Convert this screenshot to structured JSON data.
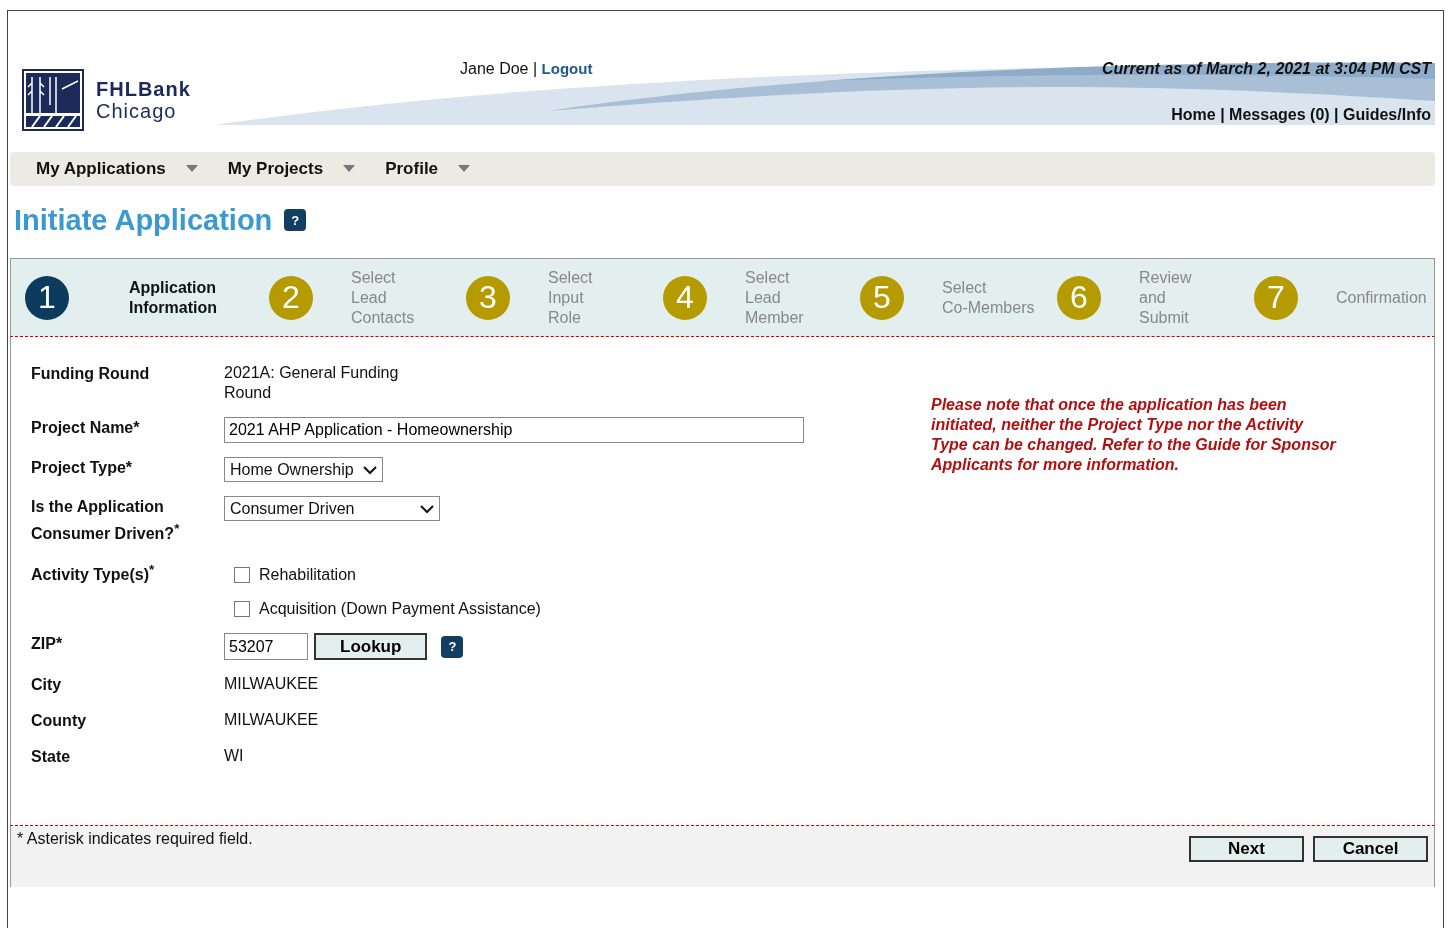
{
  "header": {
    "logo": {
      "line1": "FHLBank",
      "line2": "Chicago"
    },
    "user": "Jane Doe",
    "logout": "Logout",
    "timestamp": "Current as of March 2, 2021 at 3:04 PM CST",
    "links": [
      "Home",
      "Messages (0)",
      "Guides/Info"
    ],
    "separators": [
      "|",
      "|",
      "|"
    ]
  },
  "nav": [
    "My Applications",
    "My Projects",
    "Profile"
  ],
  "title": "Initiate Application",
  "help": "?",
  "steps": [
    {
      "number": "1",
      "lines": [
        "Application",
        "Information"
      ],
      "selected": true
    },
    {
      "number": "2",
      "lines": [
        "Select",
        "Lead",
        "Contacts"
      ],
      "selected": false
    },
    {
      "number": "3",
      "lines": [
        "Select",
        "Input",
        "Role"
      ],
      "selected": false
    },
    {
      "number": "4",
      "lines": [
        "Select",
        "Lead",
        "Member"
      ],
      "selected": false
    },
    {
      "number": "5",
      "lines": [
        "Select",
        "Co-Members"
      ],
      "selected": false
    },
    {
      "number": "6",
      "lines": [
        "Review",
        "and",
        "Submit"
      ],
      "selected": false
    },
    {
      "number": "7",
      "lines": [
        "Confirmation"
      ],
      "selected": false
    }
  ],
  "form": [
    {
      "kind": "text",
      "label": "Funding Round",
      "value": "2021A: General Funding Round"
    },
    {
      "kind": "input",
      "label": "Project Name*",
      "value": "2021 AHP Application - Homeownership"
    },
    {
      "kind": "select",
      "label": "Project Type*",
      "value": "Home Ownership"
    },
    {
      "kind": "select",
      "label": "Is the Application Consumer Driven?$^{*}$",
      "value": "Consumer Driven",
      "wide": true
    },
    {
      "kind": "checkboxes",
      "label": "Activity Type(s)$^{*}$",
      "options": [
        {
          "label": "Rehabilitation",
          "checked": false
        },
        {
          "label": "Acquisition (Down Payment Assistance)",
          "checked": false
        }
      ]
    },
    {
      "kind": "zip",
      "label": "ZIP*",
      "value": "53207",
      "button": "Lookup",
      "help": "?"
    },
    {
      "kind": "text",
      "label": "City",
      "value": "MILWAUKEE"
    },
    {
      "kind": "text",
      "label": "County",
      "value": "MILWAUKEE"
    },
    {
      "kind": "text",
      "label": "State",
      "value": "WI"
    }
  ],
  "notice": "Please note that once the application has been initiated, neither the Project Type nor the Activity Type can be changed. Refer to the Guide for Sponsor Applicants for more information.",
  "footer": {
    "note": "* Asterisk indicates required field.",
    "buttons": [
      "Next",
      "Cancel"
    ]
  }
}
